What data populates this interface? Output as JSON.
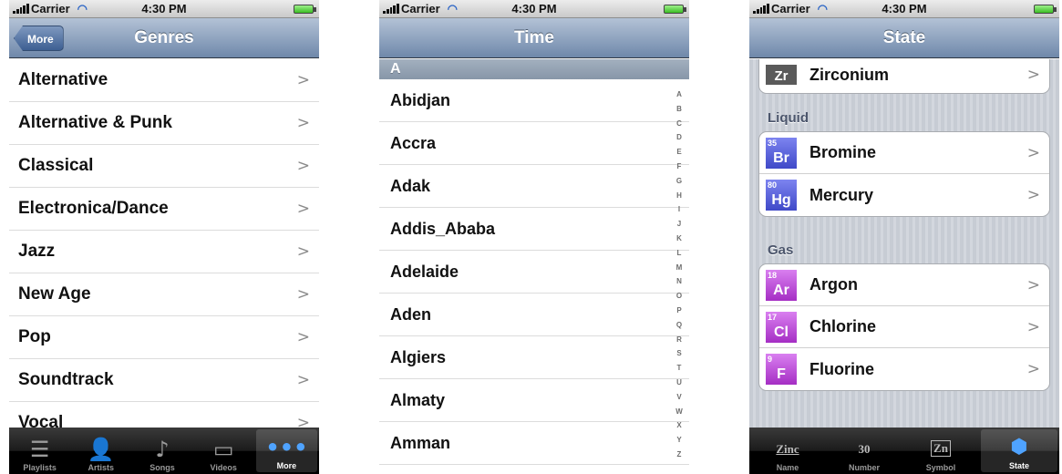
{
  "status": {
    "carrier": "Carrier",
    "time": "4:30 PM"
  },
  "genres_screen": {
    "back_label": "More",
    "title": "Genres",
    "items": [
      "Alternative",
      "Alternative & Punk",
      "Classical",
      "Electronica/Dance",
      "Jazz",
      "New Age",
      "Pop",
      "Soundtrack",
      "Vocal"
    ],
    "tabs": [
      {
        "label": "Playlists",
        "icon": "playlist-icon"
      },
      {
        "label": "Artists",
        "icon": "artists-icon"
      },
      {
        "label": "Songs",
        "icon": "music-note-icon"
      },
      {
        "label": "Videos",
        "icon": "tv-icon"
      },
      {
        "label": "More",
        "icon": "more-dots-icon"
      }
    ]
  },
  "time_screen": {
    "title": "Time",
    "section": "A",
    "items": [
      "Abidjan",
      "Accra",
      "Adak",
      "Addis_Ababa",
      "Adelaide",
      "Aden",
      "Algiers",
      "Almaty",
      "Amman"
    ],
    "index": [
      "A",
      "B",
      "C",
      "D",
      "E",
      "F",
      "G",
      "H",
      "I",
      "J",
      "K",
      "L",
      "M",
      "N",
      "O",
      "P",
      "Q",
      "R",
      "S",
      "T",
      "U",
      "V",
      "W",
      "X",
      "Y",
      "Z"
    ]
  },
  "state_screen": {
    "title": "State",
    "top_item": {
      "symbol": "Zr",
      "name": "Zirconium"
    },
    "groups": [
      {
        "label": "Liquid",
        "items": [
          {
            "number": "35",
            "symbol": "Br",
            "name": "Bromine",
            "color": "#4b55d6"
          },
          {
            "number": "80",
            "symbol": "Hg",
            "name": "Mercury",
            "color": "#4b55d6"
          }
        ]
      },
      {
        "label": "Gas",
        "items": [
          {
            "number": "18",
            "symbol": "Ar",
            "name": "Argon",
            "color": "#b43bd0"
          },
          {
            "number": "17",
            "symbol": "Cl",
            "name": "Chlorine",
            "color": "#b43bd0"
          },
          {
            "number": "9",
            "symbol": "F",
            "name": "Fluorine",
            "color": "#b43bd0"
          }
        ]
      }
    ],
    "tabs": [
      {
        "label": "Name",
        "icon_text": "Zinc"
      },
      {
        "label": "Number",
        "icon_text": "30"
      },
      {
        "label": "Symbol",
        "icon_text": "Zn"
      },
      {
        "label": "State",
        "icon_text": ""
      }
    ]
  }
}
